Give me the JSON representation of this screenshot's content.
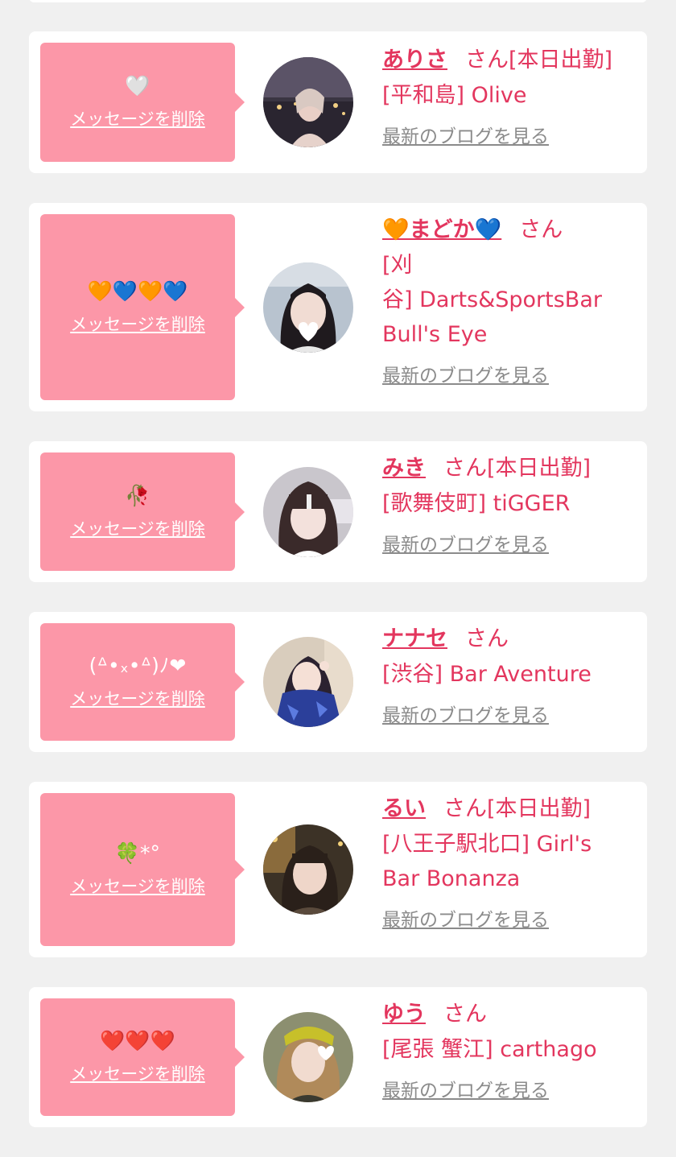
{
  "delete_label": "メッセージを削除",
  "blog_label": "最新のブログを見る",
  "messages": [
    {
      "message": "🤍",
      "name": "ありさ",
      "suffix": "さん[本日出勤]",
      "shop": "[平和島] Olive"
    },
    {
      "message": "🧡💙🧡💙",
      "name": "🧡まどか💙",
      "suffix": "さん",
      "shop_line1": "[刈",
      "shop_line2": "谷] Darts&SportsBar",
      "shop_line3": "Bull's Eye"
    },
    {
      "message": "🥀",
      "name": "みき",
      "suffix": "さん[本日出勤]",
      "shop": "[歌舞伎町] tiGGER"
    },
    {
      "message": "(ᐞ•ₓ•ᐞ)ﾉ❤",
      "name": "ナナセ",
      "suffix": "さん",
      "shop": "[渋谷] Bar Aventure"
    },
    {
      "message": "🍀*°",
      "name": "るい",
      "suffix": "さん[本日出勤]",
      "shop_line1": "[八王子駅北口] Girl's",
      "shop_line2": "Bar Bonanza"
    },
    {
      "message": "❤️❤️❤️",
      "name": "ゆう",
      "suffix": "さん",
      "shop": "[尾張 蟹江] carthago"
    }
  ]
}
